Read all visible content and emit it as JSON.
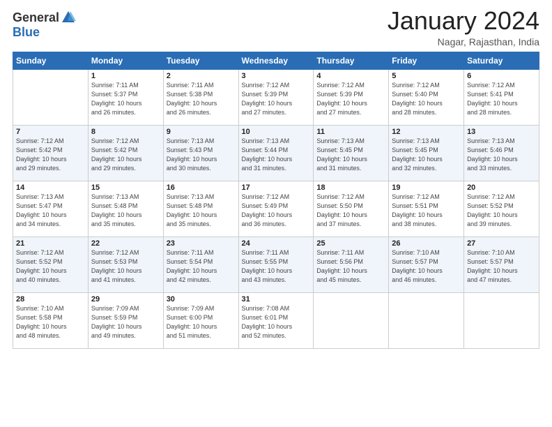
{
  "header": {
    "logo_general": "General",
    "logo_blue": "Blue",
    "month_year": "January 2024",
    "location": "Nagar, Rajasthan, India"
  },
  "weekdays": [
    "Sunday",
    "Monday",
    "Tuesday",
    "Wednesday",
    "Thursday",
    "Friday",
    "Saturday"
  ],
  "weeks": [
    [
      {
        "day": "",
        "info": ""
      },
      {
        "day": "1",
        "info": "Sunrise: 7:11 AM\nSunset: 5:37 PM\nDaylight: 10 hours\nand 26 minutes."
      },
      {
        "day": "2",
        "info": "Sunrise: 7:11 AM\nSunset: 5:38 PM\nDaylight: 10 hours\nand 26 minutes."
      },
      {
        "day": "3",
        "info": "Sunrise: 7:12 AM\nSunset: 5:39 PM\nDaylight: 10 hours\nand 27 minutes."
      },
      {
        "day": "4",
        "info": "Sunrise: 7:12 AM\nSunset: 5:39 PM\nDaylight: 10 hours\nand 27 minutes."
      },
      {
        "day": "5",
        "info": "Sunrise: 7:12 AM\nSunset: 5:40 PM\nDaylight: 10 hours\nand 28 minutes."
      },
      {
        "day": "6",
        "info": "Sunrise: 7:12 AM\nSunset: 5:41 PM\nDaylight: 10 hours\nand 28 minutes."
      }
    ],
    [
      {
        "day": "7",
        "info": "Sunrise: 7:12 AM\nSunset: 5:42 PM\nDaylight: 10 hours\nand 29 minutes."
      },
      {
        "day": "8",
        "info": "Sunrise: 7:12 AM\nSunset: 5:42 PM\nDaylight: 10 hours\nand 29 minutes."
      },
      {
        "day": "9",
        "info": "Sunrise: 7:13 AM\nSunset: 5:43 PM\nDaylight: 10 hours\nand 30 minutes."
      },
      {
        "day": "10",
        "info": "Sunrise: 7:13 AM\nSunset: 5:44 PM\nDaylight: 10 hours\nand 31 minutes."
      },
      {
        "day": "11",
        "info": "Sunrise: 7:13 AM\nSunset: 5:45 PM\nDaylight: 10 hours\nand 31 minutes."
      },
      {
        "day": "12",
        "info": "Sunrise: 7:13 AM\nSunset: 5:45 PM\nDaylight: 10 hours\nand 32 minutes."
      },
      {
        "day": "13",
        "info": "Sunrise: 7:13 AM\nSunset: 5:46 PM\nDaylight: 10 hours\nand 33 minutes."
      }
    ],
    [
      {
        "day": "14",
        "info": "Sunrise: 7:13 AM\nSunset: 5:47 PM\nDaylight: 10 hours\nand 34 minutes."
      },
      {
        "day": "15",
        "info": "Sunrise: 7:13 AM\nSunset: 5:48 PM\nDaylight: 10 hours\nand 35 minutes."
      },
      {
        "day": "16",
        "info": "Sunrise: 7:13 AM\nSunset: 5:48 PM\nDaylight: 10 hours\nand 35 minutes."
      },
      {
        "day": "17",
        "info": "Sunrise: 7:12 AM\nSunset: 5:49 PM\nDaylight: 10 hours\nand 36 minutes."
      },
      {
        "day": "18",
        "info": "Sunrise: 7:12 AM\nSunset: 5:50 PM\nDaylight: 10 hours\nand 37 minutes."
      },
      {
        "day": "19",
        "info": "Sunrise: 7:12 AM\nSunset: 5:51 PM\nDaylight: 10 hours\nand 38 minutes."
      },
      {
        "day": "20",
        "info": "Sunrise: 7:12 AM\nSunset: 5:52 PM\nDaylight: 10 hours\nand 39 minutes."
      }
    ],
    [
      {
        "day": "21",
        "info": "Sunrise: 7:12 AM\nSunset: 5:52 PM\nDaylight: 10 hours\nand 40 minutes."
      },
      {
        "day": "22",
        "info": "Sunrise: 7:12 AM\nSunset: 5:53 PM\nDaylight: 10 hours\nand 41 minutes."
      },
      {
        "day": "23",
        "info": "Sunrise: 7:11 AM\nSunset: 5:54 PM\nDaylight: 10 hours\nand 42 minutes."
      },
      {
        "day": "24",
        "info": "Sunrise: 7:11 AM\nSunset: 5:55 PM\nDaylight: 10 hours\nand 43 minutes."
      },
      {
        "day": "25",
        "info": "Sunrise: 7:11 AM\nSunset: 5:56 PM\nDaylight: 10 hours\nand 45 minutes."
      },
      {
        "day": "26",
        "info": "Sunrise: 7:10 AM\nSunset: 5:57 PM\nDaylight: 10 hours\nand 46 minutes."
      },
      {
        "day": "27",
        "info": "Sunrise: 7:10 AM\nSunset: 5:57 PM\nDaylight: 10 hours\nand 47 minutes."
      }
    ],
    [
      {
        "day": "28",
        "info": "Sunrise: 7:10 AM\nSunset: 5:58 PM\nDaylight: 10 hours\nand 48 minutes."
      },
      {
        "day": "29",
        "info": "Sunrise: 7:09 AM\nSunset: 5:59 PM\nDaylight: 10 hours\nand 49 minutes."
      },
      {
        "day": "30",
        "info": "Sunrise: 7:09 AM\nSunset: 6:00 PM\nDaylight: 10 hours\nand 51 minutes."
      },
      {
        "day": "31",
        "info": "Sunrise: 7:08 AM\nSunset: 6:01 PM\nDaylight: 10 hours\nand 52 minutes."
      },
      {
        "day": "",
        "info": ""
      },
      {
        "day": "",
        "info": ""
      },
      {
        "day": "",
        "info": ""
      }
    ]
  ]
}
